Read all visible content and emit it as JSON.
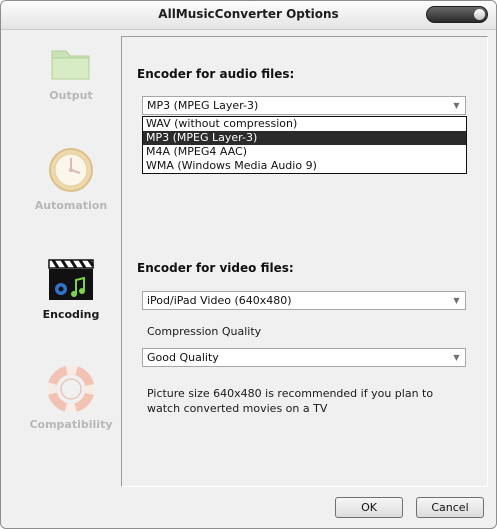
{
  "window": {
    "title": "AllMusicConverter Options"
  },
  "sidebar": {
    "items": [
      {
        "label": "Output",
        "icon": "folder-icon",
        "active": false
      },
      {
        "label": "Automation",
        "icon": "clock-icon",
        "active": false
      },
      {
        "label": "Encoding",
        "icon": "clapperboard-icon",
        "active": true
      },
      {
        "label": "Compatibility",
        "icon": "lifebuoy-icon",
        "active": false
      }
    ]
  },
  "audio": {
    "label": "Encoder for audio files:",
    "selected": "MP3 (MPEG Layer-3)",
    "options": [
      "WAV (without compression)",
      "MP3 (MPEG Layer-3)",
      "M4A (MPEG4 AAC)",
      "WMA (Windows Media Audio 9)"
    ]
  },
  "video": {
    "label": "Encoder for video files:",
    "selected": "iPod/iPad Video (640x480)",
    "quality_label": "Compression Quality",
    "quality_selected": "Good Quality",
    "hint_line1": "Picture size 640x480 is recommended if you plan to",
    "hint_line2": "watch converted movies on a TV"
  },
  "buttons": {
    "ok": "OK",
    "cancel": "Cancel"
  }
}
